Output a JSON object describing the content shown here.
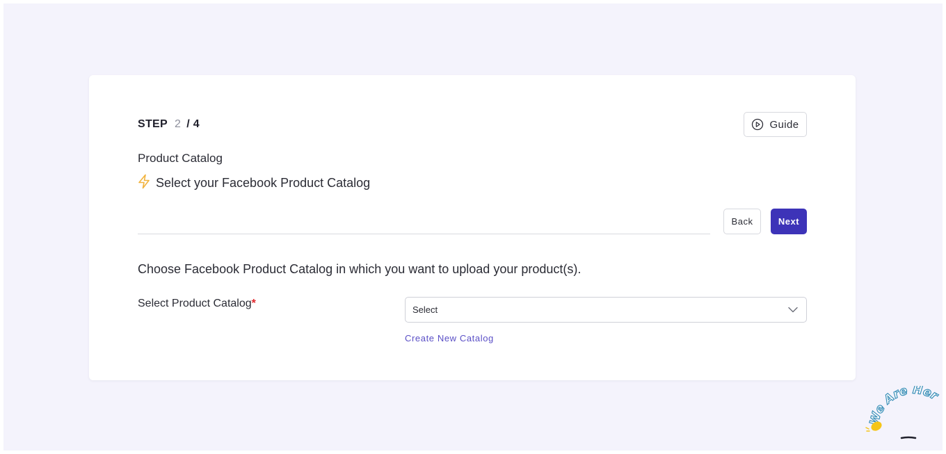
{
  "step": {
    "label": "STEP",
    "current": "2",
    "total": "/ 4"
  },
  "guide_button": {
    "label": "Guide",
    "icon": "play-circle-icon"
  },
  "header": {
    "title": "Product Catalog",
    "subtitle": "Select your Facebook Product Catalog",
    "subtitle_icon": "lightning-bolt-icon"
  },
  "nav": {
    "back_label": "Back",
    "next_label": "Next"
  },
  "instructions": "Choose Facebook Product Catalog in which you want to upload your product(s).",
  "form": {
    "catalog_label": "Select Product Catalog",
    "required_mark": "*",
    "catalog_select_value": "Select",
    "create_link": "Create New Catalog"
  },
  "chat_widget": {
    "text": "We Are Here!",
    "icon": "waving-hand-icon"
  },
  "colors": {
    "background": "#f4f3fc",
    "primary": "#3d33b8",
    "link": "#5a4fc6",
    "required": "#e0262b",
    "bolt": "#f2b33d"
  }
}
